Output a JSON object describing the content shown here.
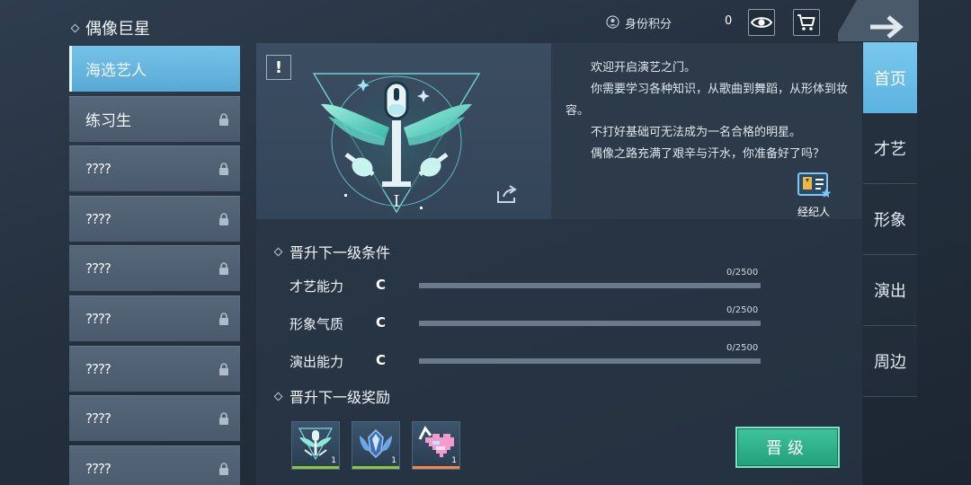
{
  "sidebar": {
    "title": "偶像巨星",
    "items": [
      {
        "label": "海选艺人",
        "locked": false,
        "active": true
      },
      {
        "label": "练习生",
        "locked": true,
        "active": false
      },
      {
        "label": "????",
        "locked": true,
        "active": false
      },
      {
        "label": "????",
        "locked": true,
        "active": false
      },
      {
        "label": "????",
        "locked": true,
        "active": false
      },
      {
        "label": "????",
        "locked": true,
        "active": false
      },
      {
        "label": "????",
        "locked": true,
        "active": false
      },
      {
        "label": "????",
        "locked": true,
        "active": false
      },
      {
        "label": "????",
        "locked": true,
        "active": false
      }
    ]
  },
  "topbar": {
    "score_label": "身份积分",
    "score_value": "0",
    "icons": [
      "profile-badge-icon",
      "eye-icon",
      "cart-icon",
      "back-arrow-icon"
    ]
  },
  "nav": {
    "tabs": [
      {
        "label": "首页",
        "active": true
      },
      {
        "label": "才艺",
        "active": false
      },
      {
        "label": "形象",
        "active": false
      },
      {
        "label": "演出",
        "active": false
      },
      {
        "label": "周边",
        "active": false
      }
    ]
  },
  "emblem": {
    "alert": "!",
    "rank_numeral": "I"
  },
  "description": {
    "paragraphs": [
      "欢迎开启演艺之门。",
      "你需要学习各种知识，从歌曲到舞蹈，从形体到妆容。",
      "不打好基础可无法成为一名合格的明星。",
      "偶像之路充满了艰辛与汗水，你准备好了吗？"
    ],
    "agent_label": "经纪人"
  },
  "conditions": {
    "title": "晋升下一级条件",
    "rows": [
      {
        "label": "才艺能力",
        "grade": "C",
        "progress": "0/2500",
        "fraction": 0
      },
      {
        "label": "形象气质",
        "grade": "C",
        "progress": "0/2500",
        "fraction": 0
      },
      {
        "label": "演出能力",
        "grade": "C",
        "progress": "0/2500",
        "fraction": 0
      }
    ]
  },
  "rewards": {
    "title": "晋升下一级奖励",
    "items": [
      {
        "icon": "emblem-badge-icon",
        "quantity": "1",
        "rarity_color": "#8cc63f"
      },
      {
        "icon": "wings-crest-icon",
        "quantity": "1",
        "rarity_color": "#8cc63f"
      },
      {
        "icon": "pixel-heart-icon",
        "quantity": "1",
        "rarity_color": "#f0874d"
      }
    ]
  },
  "actions": {
    "upgrade_label": "晋级"
  },
  "colors": {
    "accent_blue": "#5cb3e0",
    "upgrade_green": "#2db388",
    "bar_fill": "#9fd2ef"
  }
}
